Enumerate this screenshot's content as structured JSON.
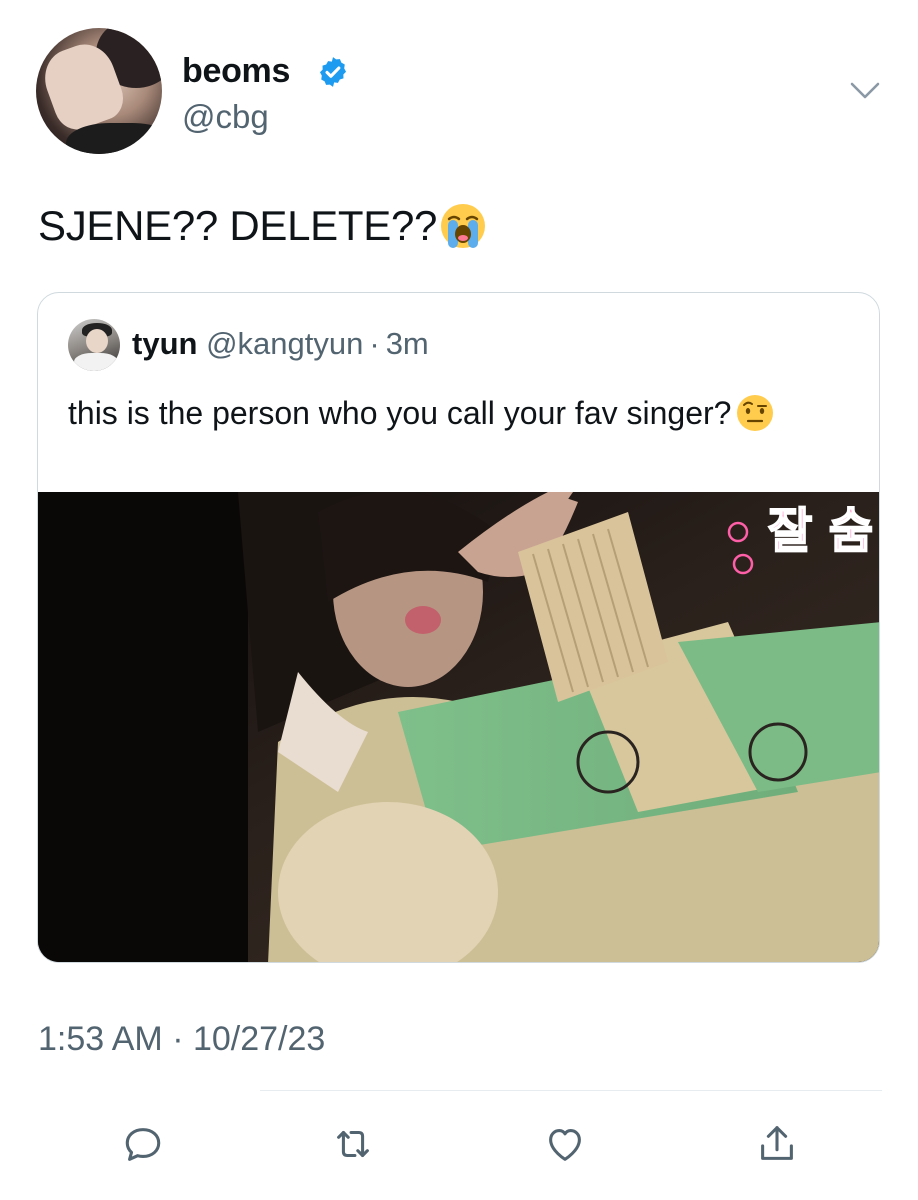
{
  "tweet": {
    "author_name": "beoms",
    "author_handle": "@cbg",
    "text": "SJENE?? DELETE??",
    "timestamp": "1:53 AM · 10/27/23"
  },
  "quote": {
    "name": "tyun",
    "handle": "@kangtyun",
    "separator": "·",
    "time": "3m",
    "text": "this is the person who you call your fav singer?",
    "overlay_text": "잘 숨"
  },
  "actions": [
    "reply-icon",
    "retweet-icon",
    "like-icon",
    "share-icon"
  ],
  "colors": {
    "text": "#0f1419",
    "secondary": "#536471",
    "verified": "#1d9bf0",
    "border": "#cfd9de"
  }
}
